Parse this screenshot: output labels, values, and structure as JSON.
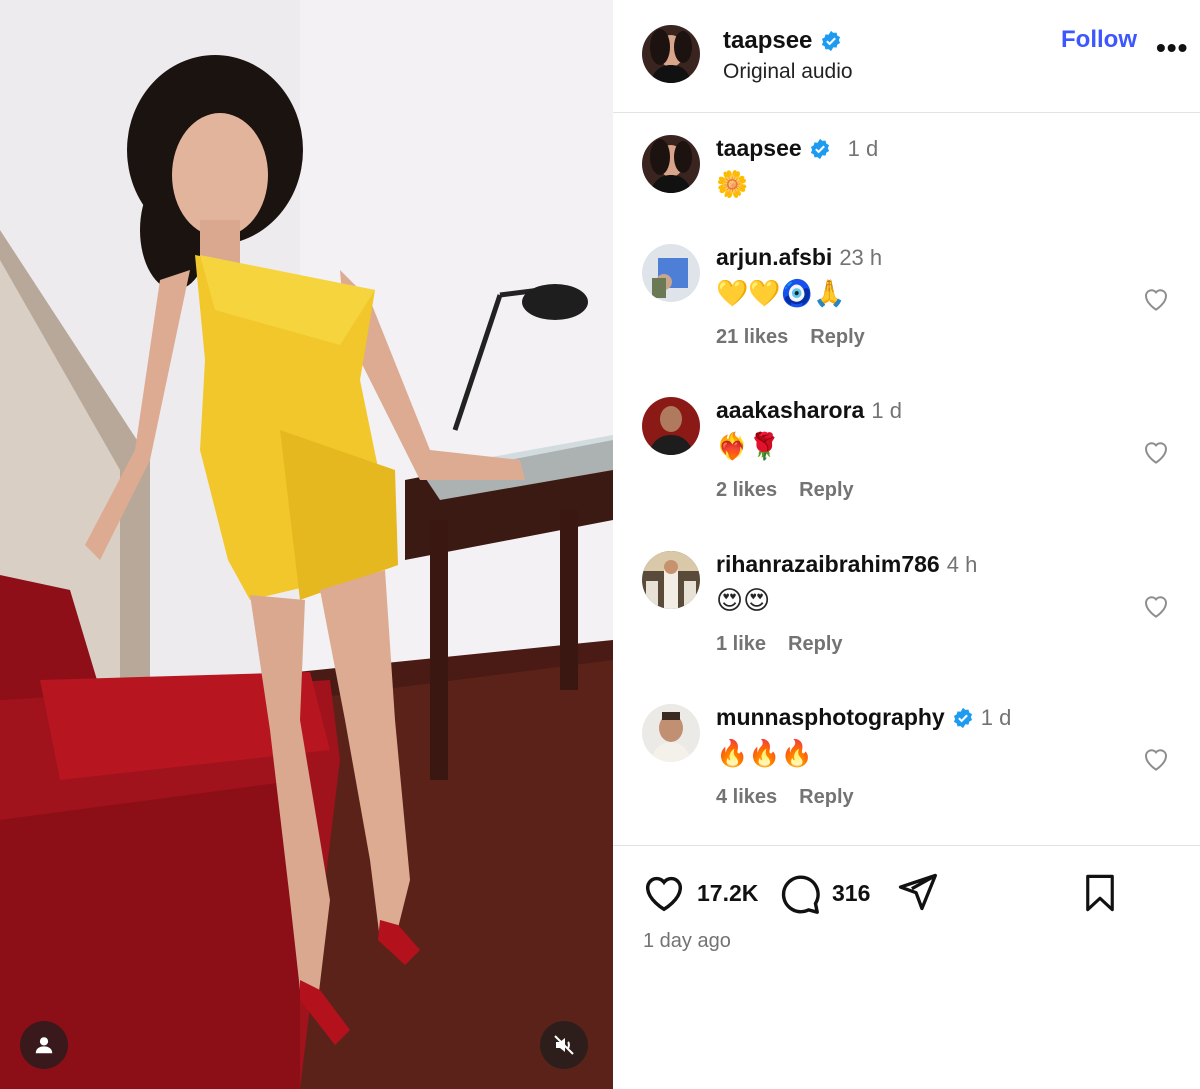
{
  "post": {
    "author": "taapsee",
    "verified": true,
    "subtitle": "Original audio",
    "follow_label": "Follow",
    "more_label": "•••"
  },
  "caption": {
    "author": "taapsee",
    "time": "1 d",
    "text": "🌼"
  },
  "comments": [
    {
      "user": "arjun.afsbi",
      "verified": false,
      "time": "23 h",
      "text": "💛💛🧿🙏",
      "likes": "21 likes",
      "reply": "Reply"
    },
    {
      "user": "aaakasharora",
      "verified": false,
      "time": "1 d",
      "text": "❤️‍🔥🌹",
      "likes": "2 likes",
      "reply": "Reply"
    },
    {
      "user": "rihanrazaibrahim786",
      "verified": false,
      "time": "4 h",
      "text": "😍😍",
      "likes": "1 like",
      "reply": "Reply"
    },
    {
      "user": "munnasphotography",
      "verified": true,
      "time": "1 d",
      "text": "🔥🔥🔥",
      "likes": "4 likes",
      "reply": "Reply"
    }
  ],
  "stats": {
    "likes": "17.2K",
    "comments": "316",
    "posted": "1 day ago"
  },
  "icons": {
    "tag": "user-tag-icon",
    "mute": "muted-speaker-icon",
    "like": "heart-icon",
    "comment": "comment-bubble-icon",
    "share": "paper-plane-icon",
    "save": "bookmark-icon"
  },
  "colors": {
    "accent": "#3d56ff",
    "verified": "#1d9bf0",
    "muted_text": "#737373"
  }
}
